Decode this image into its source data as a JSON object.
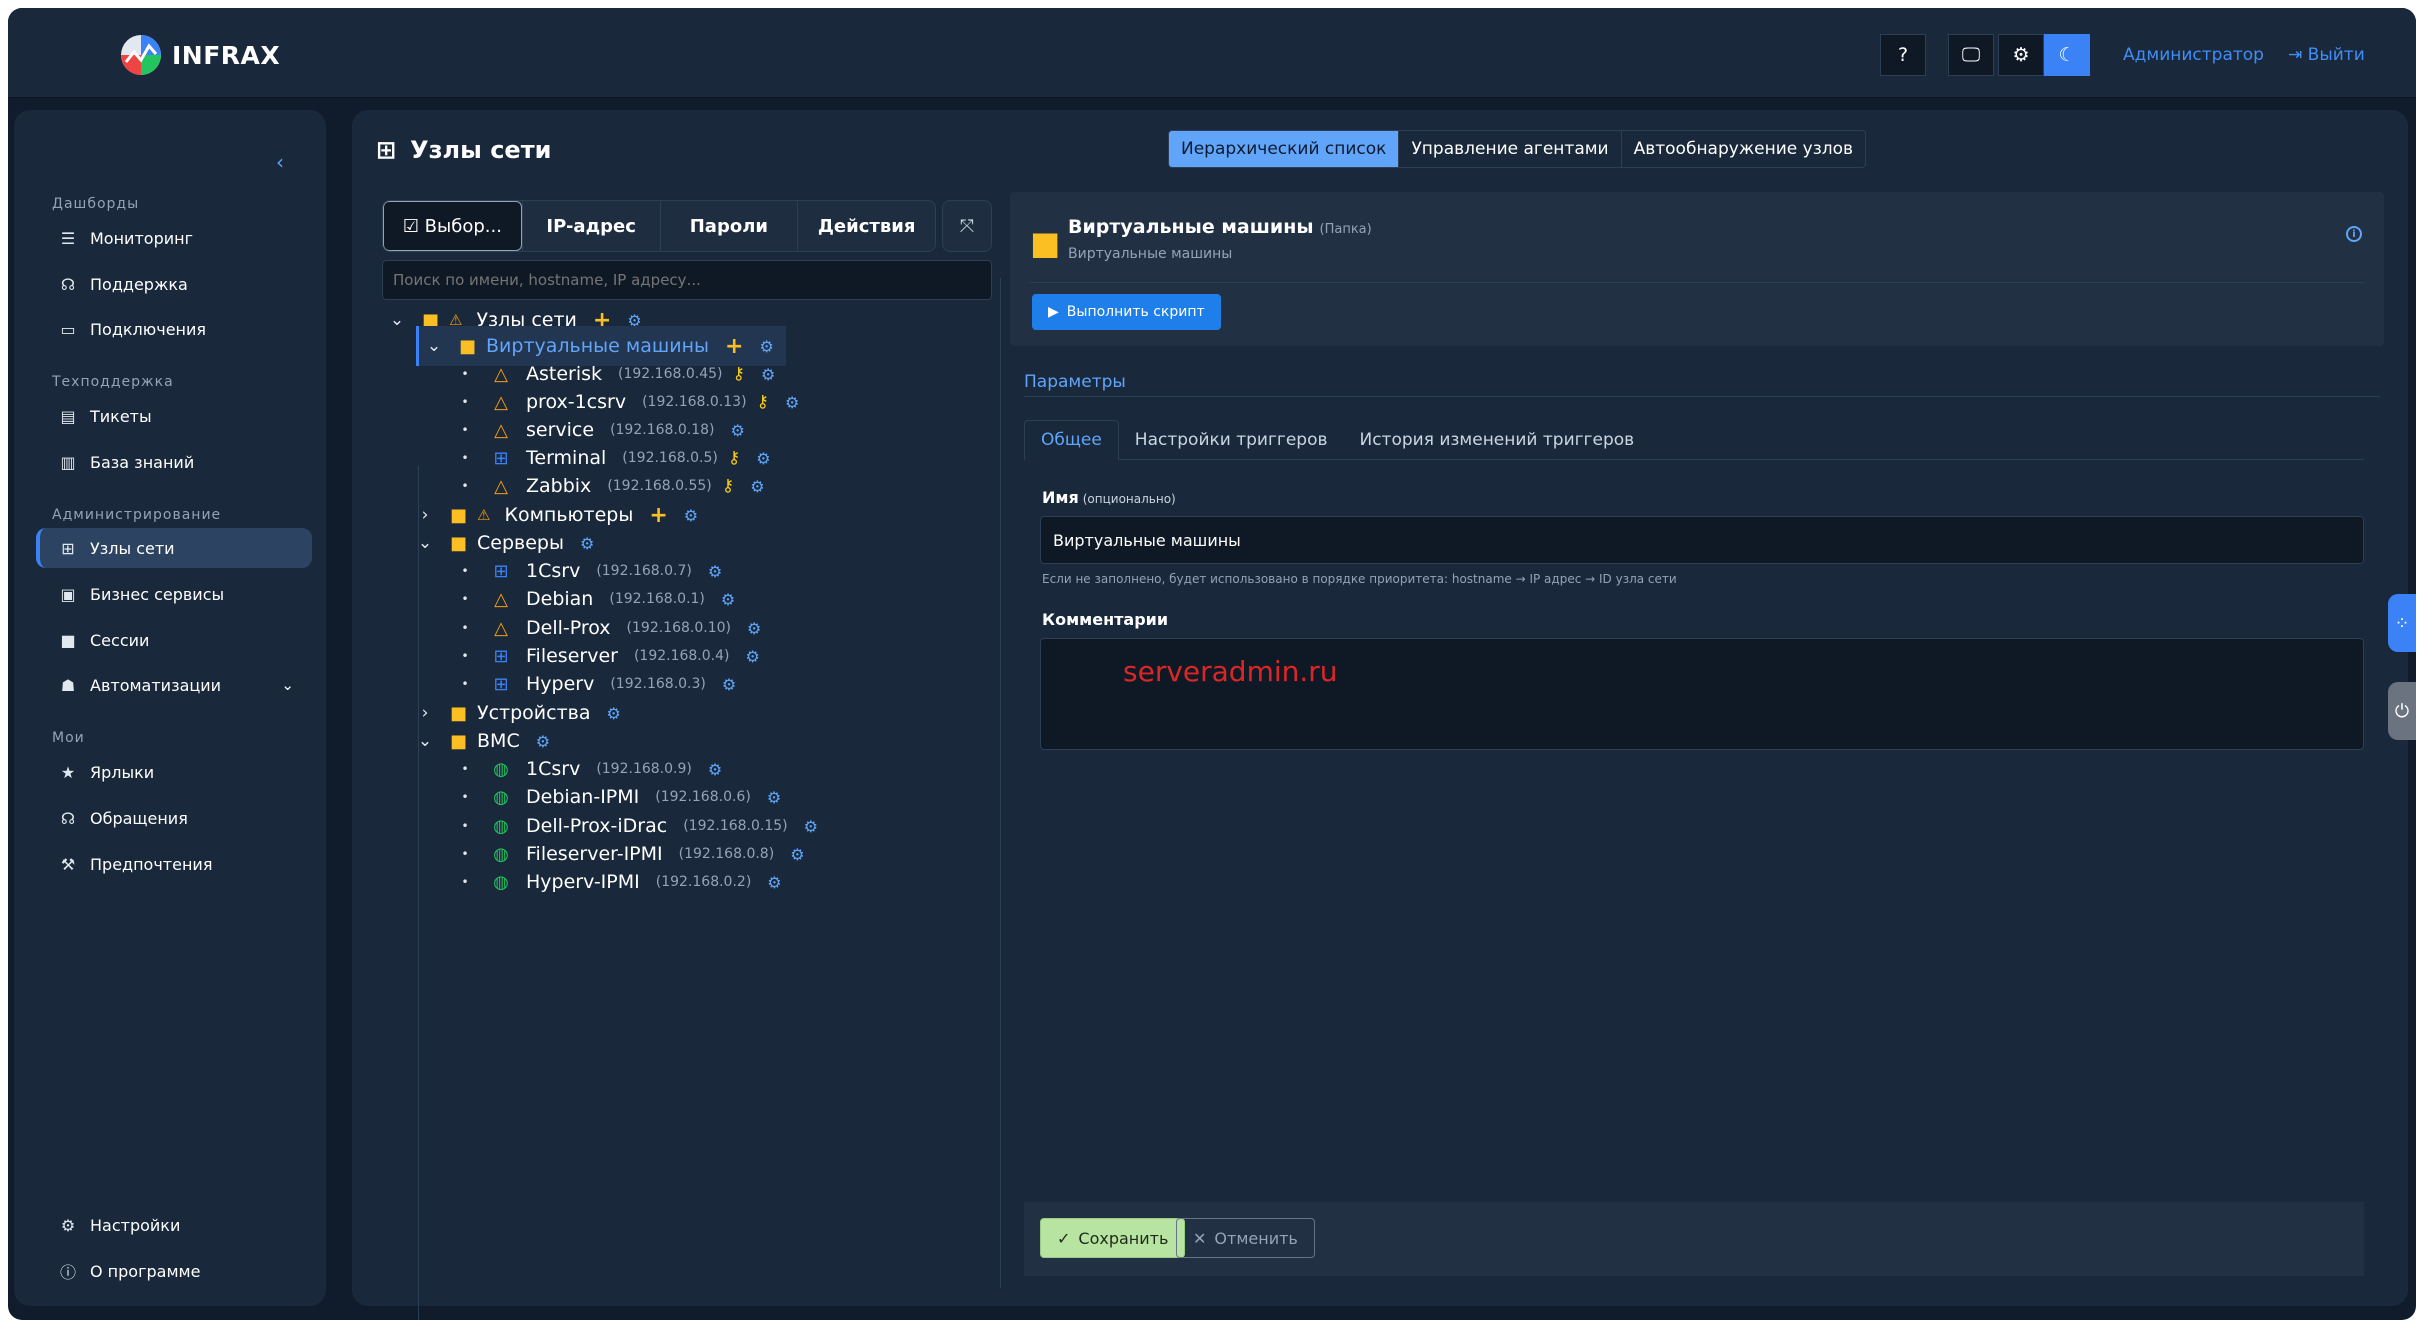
{
  "header": {
    "logo_text": "INFRAX",
    "help_label": "?",
    "user_label": "Администратор",
    "logout_label": "Выйти"
  },
  "sidebar": {
    "collapse_label": "‹",
    "sections": [
      {
        "title": "Дашборды",
        "items": [
          "Мониторинг",
          "Поддержка",
          "Подключения"
        ]
      },
      {
        "title": "Техподдержка",
        "items": [
          "Тикеты",
          "База знаний"
        ]
      },
      {
        "title": "Администрирование",
        "items": [
          "Узлы сети",
          "Бизнес сервисы",
          "Сессии",
          "Автоматизации"
        ]
      },
      {
        "title": "Мои",
        "items": [
          "Ярлыки",
          "Обращения",
          "Предпочтения"
        ]
      }
    ],
    "bottom": [
      "Настройки",
      "О программе"
    ],
    "active_item": "Узлы сети"
  },
  "page": {
    "title": "Узлы сети",
    "view_tabs": [
      "Иерархический список",
      "Управление агентами",
      "Автообнаружение узлов"
    ],
    "active_view_tab": "Иерархический список"
  },
  "tree_toolbar": {
    "select_label": "☑ Выбор...",
    "ip_label": "IP-адрес",
    "passwords_label": "Пароли",
    "actions_label": "Действия",
    "search_placeholder": "Поиск по имени, hostname, IP адресу..."
  },
  "tree": {
    "root": "Узлы сети",
    "folders": {
      "vm": "Виртуальные машины",
      "pcs": "Компьютеры",
      "servers": "Серверы",
      "devices": "Устройства",
      "bmc": "BMC"
    },
    "vm_nodes": [
      {
        "name": "Asterisk",
        "ip": "(192.168.0.45)"
      },
      {
        "name": "prox-1csrv",
        "ip": "(192.168.0.13)"
      },
      {
        "name": "service",
        "ip": "(192.168.0.18)"
      },
      {
        "name": "Terminal",
        "ip": "(192.168.0.5)"
      },
      {
        "name": "Zabbix",
        "ip": "(192.168.0.55)"
      }
    ],
    "server_nodes": [
      {
        "name": "1Csrv",
        "ip": "(192.168.0.7)"
      },
      {
        "name": "Debian",
        "ip": "(192.168.0.1)"
      },
      {
        "name": "Dell-Prox",
        "ip": "(192.168.0.10)"
      },
      {
        "name": "Fileserver",
        "ip": "(192.168.0.4)"
      },
      {
        "name": "Hyperv",
        "ip": "(192.168.0.3)"
      }
    ],
    "bmc_nodes": [
      {
        "name": "1Csrv",
        "ip": "(192.168.0.9)"
      },
      {
        "name": "Debian-IPMI",
        "ip": "(192.168.0.6)"
      },
      {
        "name": "Dell-Prox-iDrac",
        "ip": "(192.168.0.15)"
      },
      {
        "name": "Fileserver-IPMI",
        "ip": "(192.168.0.8)"
      },
      {
        "name": "Hyperv-IPMI",
        "ip": "(192.168.0.2)"
      }
    ]
  },
  "detail": {
    "title": "Виртуальные машины",
    "type": "(Папка)",
    "subtitle": "Виртуальные машины",
    "run_script_label": "Выполнить скрипт",
    "params_tab": "Параметры",
    "sub_tabs": [
      "Общее",
      "Настройки триггеров",
      "История изменений триггеров"
    ],
    "active_sub_tab": "Общее",
    "name_label": "Имя",
    "name_optional": "(опционально)",
    "name_value": "Виртуальные машины",
    "name_hint": "Если не заполнено, будет использовано в порядке приоритета: hostname → IP адрес → ID узла сети",
    "comment_label": "Комментарии",
    "watermark": "serveradmin.ru",
    "save_label": "Сохранить",
    "cancel_label": "Отменить"
  },
  "colors": {
    "accent": "#3b82f6",
    "folder": "#fbbf24",
    "linux": "#f59e0b",
    "windows": "#3b82f6",
    "bmc": "#22c55e",
    "save": "#b7e4a0"
  }
}
